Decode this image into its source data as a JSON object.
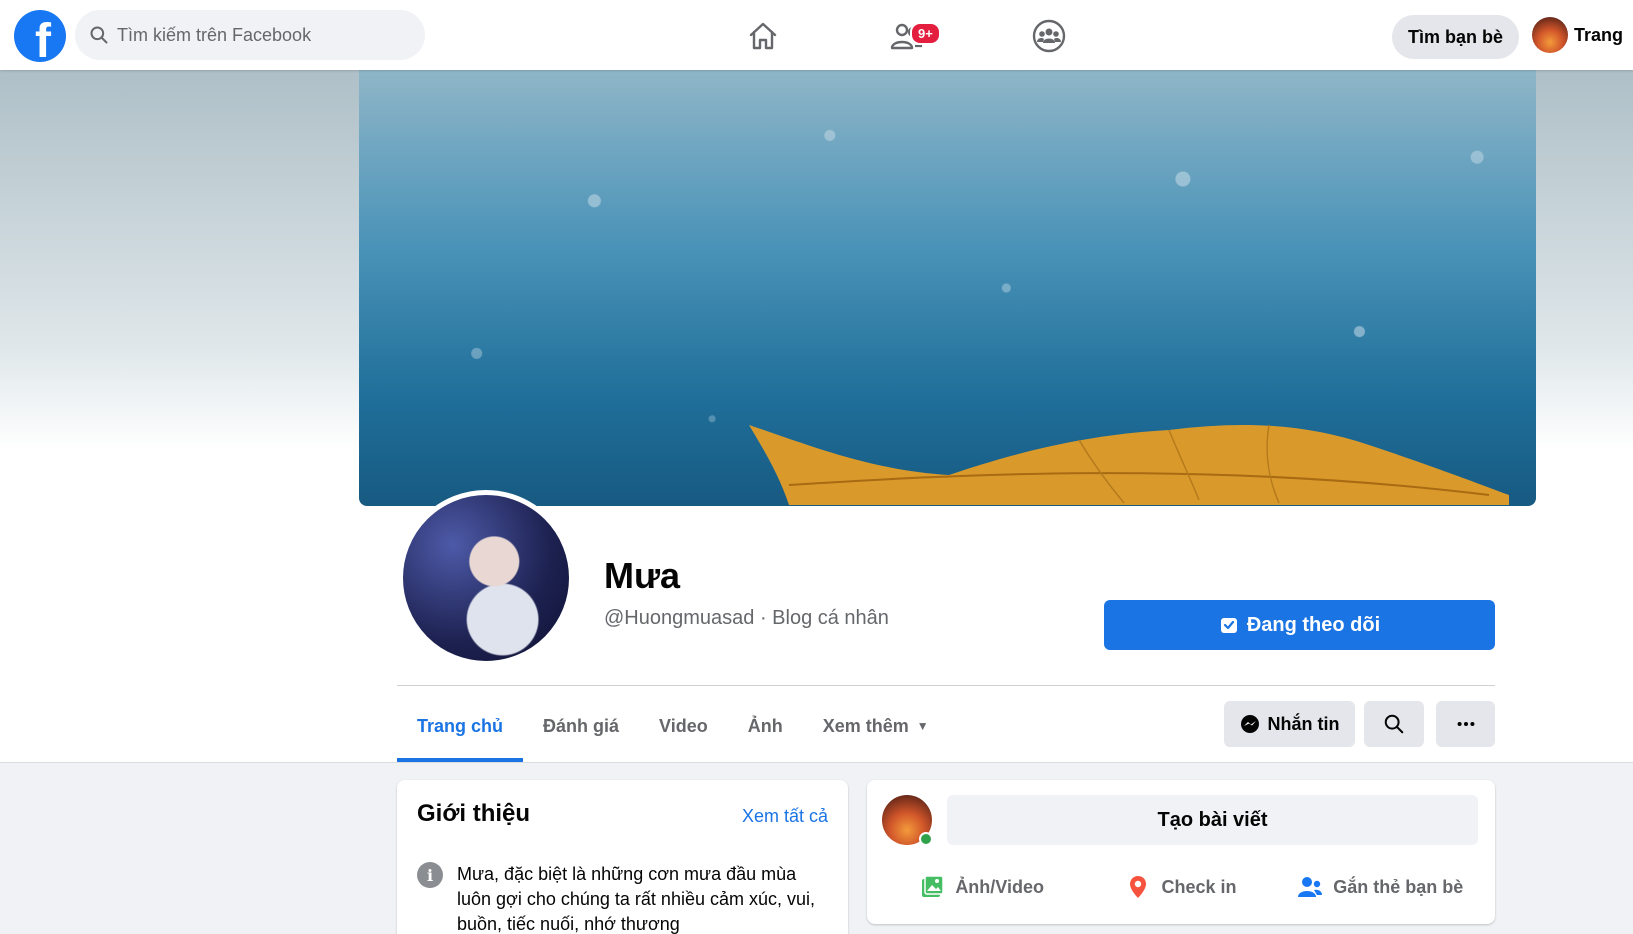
{
  "topbar": {
    "logo_letter": "f",
    "search_placeholder": "Tìm kiếm trên Facebook",
    "friends_badge": "9+",
    "find_friends_label": "Tìm bạn bè",
    "user_name": "Trang"
  },
  "profile": {
    "name": "Mưa",
    "subtitle": "@Huongmuasad · Blog cá nhân",
    "follow_label": "Đang theo dõi"
  },
  "tabs": [
    {
      "label": "Trang chủ",
      "active": true
    },
    {
      "label": "Đánh giá"
    },
    {
      "label": "Video"
    },
    {
      "label": "Ảnh"
    },
    {
      "label": "Xem thêm"
    }
  ],
  "actions": {
    "message_label": "Nhắn tin"
  },
  "intro": {
    "title": "Giới thiệu",
    "see_all": "Xem tất cả",
    "info_icon": "i",
    "text": "Mưa, đặc biệt là những cơn mưa đầu mùa luôn gợi cho chúng ta rất nhiều cảm xúc, vui, buồn, tiếc nuối, nhớ thương"
  },
  "composer": {
    "create_post": "Tạo bài viết",
    "photo_video": "Ảnh/Video",
    "check_in": "Check in",
    "tag_friends": "Gắn thẻ bạn bè"
  },
  "colors": {
    "brand": "#1877f2",
    "accent": "#1b74e4",
    "badge": "#e41e3f",
    "online": "#31a24c"
  }
}
